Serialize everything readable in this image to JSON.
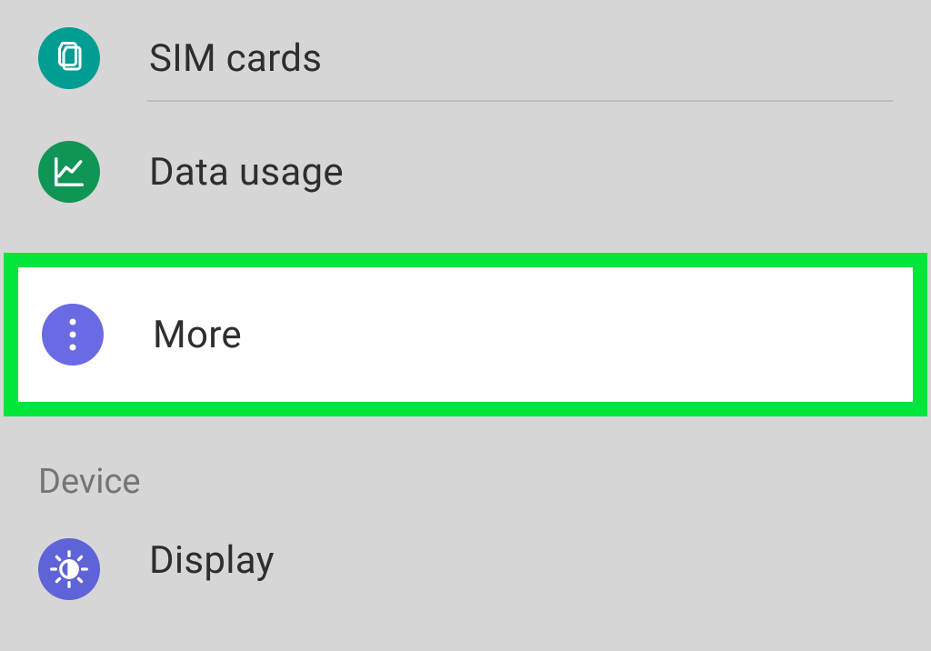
{
  "settings": {
    "items": [
      {
        "id": "sim",
        "label": "SIM cards",
        "icon": "sim-icon",
        "color": "teal"
      },
      {
        "id": "data",
        "label": "Data usage",
        "icon": "chart-icon",
        "color": "green"
      },
      {
        "id": "more",
        "label": "More",
        "icon": "more-icon",
        "color": "indigo",
        "highlighted": true
      }
    ],
    "section_header": "Device",
    "device_items": [
      {
        "id": "display",
        "label": "Display",
        "icon": "brightness-icon",
        "color": "purple"
      }
    ]
  }
}
